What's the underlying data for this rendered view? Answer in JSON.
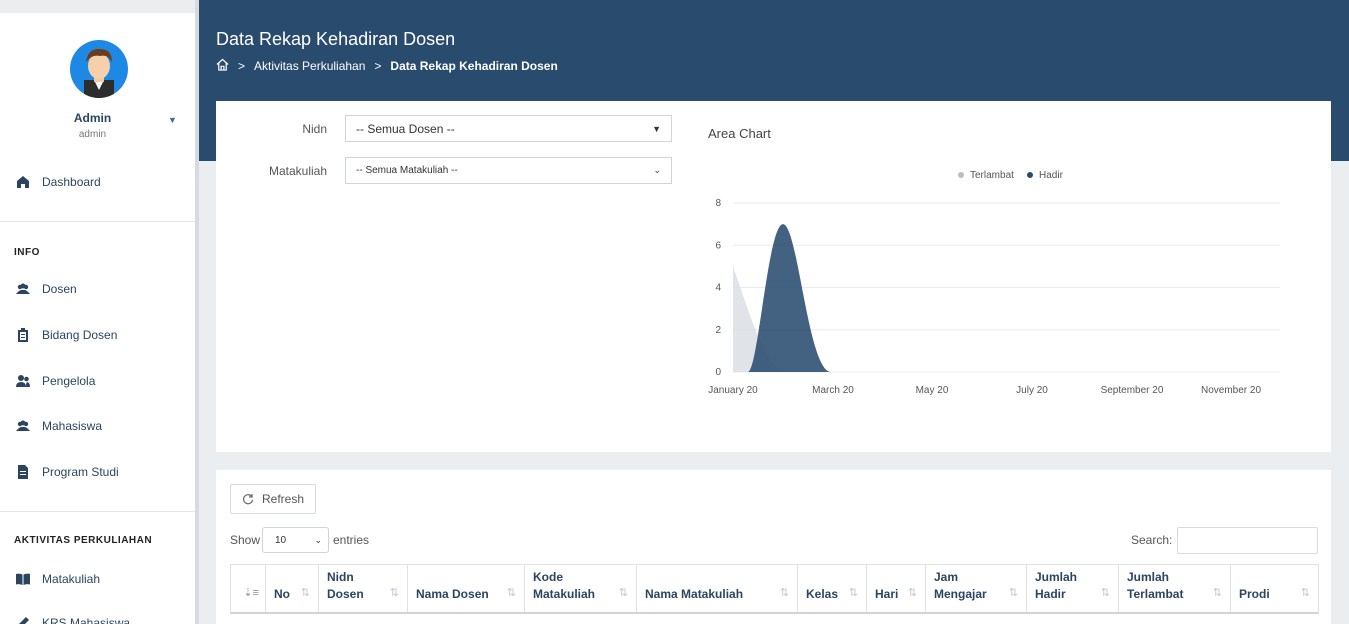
{
  "user": {
    "name": "Admin",
    "role": "admin"
  },
  "sidebar": {
    "dashboard": "Dashboard",
    "section_info": "INFO",
    "info_items": [
      "Dosen",
      "Bidang Dosen",
      "Pengelola",
      "Mahasiswa",
      "Program Studi"
    ],
    "section_aktivitas": "AKTIVITAS PERKULIAHAN",
    "aktivitas_items": [
      "Matakuliah",
      "KRS Mahasiswa"
    ]
  },
  "header": {
    "title": "Data Rekap Kehadiran Dosen",
    "breadcrumb": [
      "Aktivitas Perkuliahan",
      "Data Rekap Kehadiran Dosen"
    ]
  },
  "filters": {
    "nidn_label": "Nidn",
    "nidn_value": "-- Semua Dosen --",
    "matakuliah_label": "Matakuliah",
    "matakuliah_value": "-- Semua Matakuliah --"
  },
  "chart_data": {
    "type": "area",
    "title": "Area Chart",
    "x": [
      "January 20",
      "March 20",
      "May 20",
      "July 20",
      "September 20",
      "November 20"
    ],
    "yticks": [
      "0",
      "2",
      "4",
      "6",
      "8"
    ],
    "ylim": [
      0,
      8
    ],
    "legend_position": "top-center",
    "series": [
      {
        "name": "Terlambat",
        "color": "#d5dbe2",
        "points": [
          [
            0,
            5
          ],
          [
            0.5,
            0
          ]
        ]
      },
      {
        "name": "Hadir",
        "color": "#294b6e",
        "points": [
          [
            0,
            0
          ],
          [
            0.15,
            0
          ],
          [
            0.5,
            7
          ],
          [
            0.85,
            0
          ],
          [
            1,
            0
          ]
        ]
      }
    ]
  },
  "table": {
    "refresh_label": "Refresh",
    "show_label": "Show",
    "entries_value": "10",
    "entries_label": "entries",
    "search_label": "Search:",
    "columns": [
      "",
      "No",
      "Nidn Dosen",
      "Nama Dosen",
      "Kode Matakuliah",
      "Nama Matakuliah",
      "Kelas",
      "Hari",
      "Jam Mengajar",
      "Jumlah Hadir",
      "Jumlah Terlambat",
      "Prodi"
    ]
  }
}
